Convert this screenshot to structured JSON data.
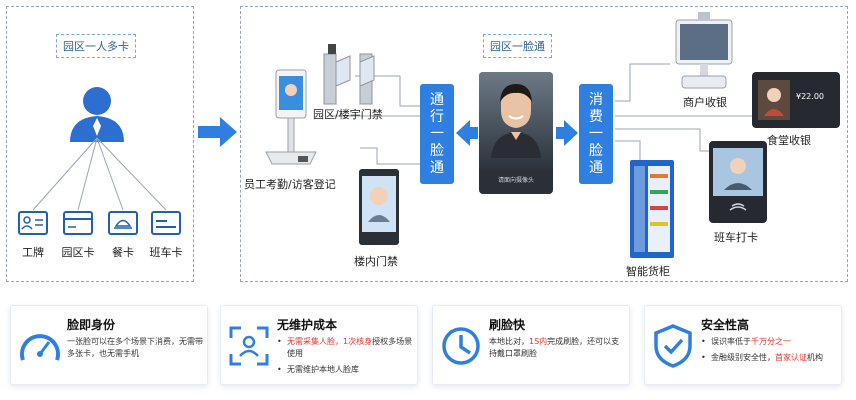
{
  "left_panel": {
    "title": "园区一人多卡",
    "cards": [
      {
        "label": "工牌",
        "icon": "badge-icon"
      },
      {
        "label": "园区卡",
        "icon": "park-card-icon"
      },
      {
        "label": "餐卡",
        "icon": "meal-card-icon"
      },
      {
        "label": "班车卡",
        "icon": "shuttle-card-icon"
      }
    ]
  },
  "right_panel": {
    "title": "园区一脸通",
    "left_pill": [
      "通",
      "行",
      "一",
      "脸",
      "通"
    ],
    "right_pill": [
      "消",
      "费",
      "一",
      "脸",
      "通"
    ],
    "phone_screen_text": "请面向摄像头",
    "devices": {
      "gate": "园区/楼宇门禁",
      "attendance": "员工考勤/访客登记",
      "indoor": "楼内门禁",
      "merchant": "商户收银",
      "canteen": "食堂收银",
      "shuttle": "班车打卡",
      "vending": "智能货柜"
    },
    "canteen_amount": "¥22.00"
  },
  "features": [
    {
      "title": "脸即身份",
      "icon": "speedometer-icon",
      "text": "一张脸可以在多个场景下消费，无需带多张卡，也无需手机"
    },
    {
      "title": "无维护成本",
      "icon": "face-scan-icon",
      "b1_red1": "无需采集人脸，",
      "b1_red2": "1次核身",
      "b1_rest": "授权多场景使用",
      "b2": "无需维护本地人脸库"
    },
    {
      "title": "刷脸快",
      "icon": "clock-icon",
      "t_pre": "本地比对，",
      "t_red": "1S内",
      "t_post": "完成刷脸，还可以支持戴口罩刷脸"
    },
    {
      "title": "安全性高",
      "icon": "shield-icon",
      "b1_pre": "误识率低于",
      "b1_red": "千万分之一",
      "b2_pre": "金融级别安全性，",
      "b2_red": "首家认证",
      "b2_post": "机构"
    }
  ],
  "colors": {
    "accent": "#2f7fe0",
    "highlight": "#e8312a",
    "person": "#2d6fd0"
  }
}
